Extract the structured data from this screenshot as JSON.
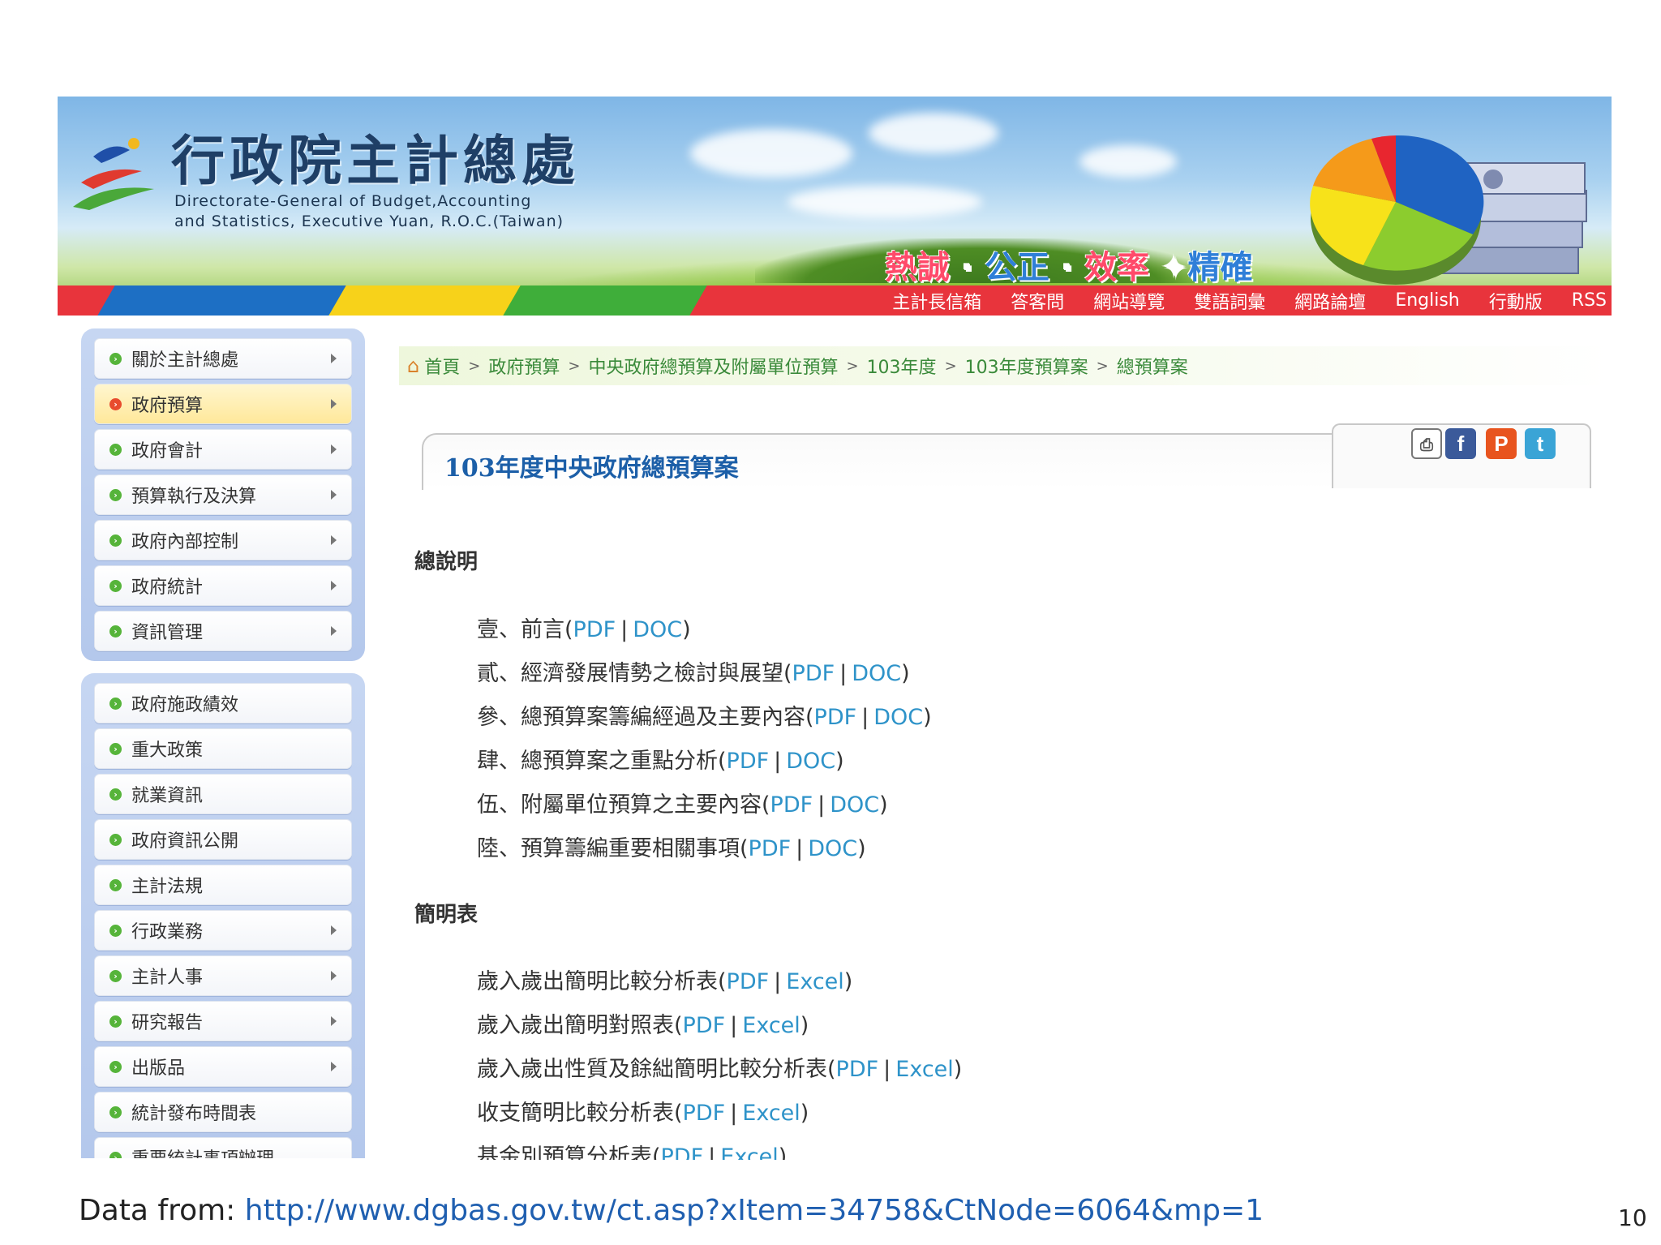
{
  "header": {
    "title": "行政院主計總處",
    "subtitle_line1": "Directorate-General of Budget,Accounting",
    "subtitle_line2": "and Statistics, Executive Yuan, R.O.C.(Taiwan)",
    "slogan": [
      "熱誠",
      "公正",
      "效率",
      "精確"
    ],
    "nav_links": [
      "主計長信箱",
      "答客問",
      "網站導覽",
      "雙語詞彙",
      "網路論壇",
      "English",
      "行動版",
      "RSS"
    ]
  },
  "sidebar": {
    "group1": [
      "關於主計總處",
      "政府預算",
      "政府會計",
      "預算執行及決算",
      "政府內部控制",
      "政府統計",
      "資訊管理"
    ],
    "group2": [
      "政府施政績效",
      "重大政策",
      "就業資訊",
      "政府資訊公開",
      "主計法規",
      "行政業務",
      "主計人事",
      "研究報告",
      "出版品",
      "統計發布時間表",
      "重要統計事項辦理"
    ]
  },
  "breadcrumb": [
    "首頁",
    "政府預算",
    "中央政府總預算及附屬單位預算",
    "103年度",
    "103年度預算案",
    "總預算案"
  ],
  "page_title": "103年度中央政府總預算案",
  "share_icons": [
    "print-icon",
    "facebook-icon",
    "plurk-icon",
    "twitter-icon"
  ],
  "sections": [
    {
      "heading": "總說明",
      "items": [
        {
          "text": "壹、前言",
          "links": [
            "PDF",
            "DOC"
          ]
        },
        {
          "text": "貳、經濟發展情勢之檢討與展望",
          "links": [
            "PDF",
            "DOC"
          ]
        },
        {
          "text": "參、總預算案籌編經過及主要內容",
          "links": [
            "PDF",
            "DOC"
          ]
        },
        {
          "text": "肆、總預算案之重點分析",
          "links": [
            "PDF",
            "DOC"
          ]
        },
        {
          "text": "伍、附屬單位預算之主要內容",
          "links": [
            "PDF",
            "DOC"
          ]
        },
        {
          "text": "陸、預算籌編重要相關事項",
          "links": [
            "PDF",
            "DOC"
          ]
        }
      ]
    },
    {
      "heading": "簡明表",
      "items": [
        {
          "text": "歲入歲出簡明比較分析表",
          "links": [
            "PDF",
            "Excel"
          ]
        },
        {
          "text": "歲入歲出簡明對照表",
          "links": [
            "PDF",
            "Excel"
          ]
        },
        {
          "text": "歲入歲出性質及餘絀簡明比較分析表",
          "links": [
            "PDF",
            "Excel"
          ]
        },
        {
          "text": "收支簡明比較分析表",
          "links": [
            "PDF",
            "Excel"
          ]
        },
        {
          "text": "基金別預算分析表",
          "links": [
            "PDF",
            "Excel"
          ]
        }
      ]
    }
  ],
  "footer": {
    "source_label": "Data from: ",
    "source_url": "http://www.dgbas.gov.tw/ct.asp?xItem=34758&CtNode=6064&mp=1",
    "page_number": "10"
  },
  "colors": {
    "nav_red": "#e8343c",
    "link_blue": "#2e93c9",
    "breadcrumb_green": "#3a8a3a",
    "title_blue": "#1c5fa8"
  }
}
